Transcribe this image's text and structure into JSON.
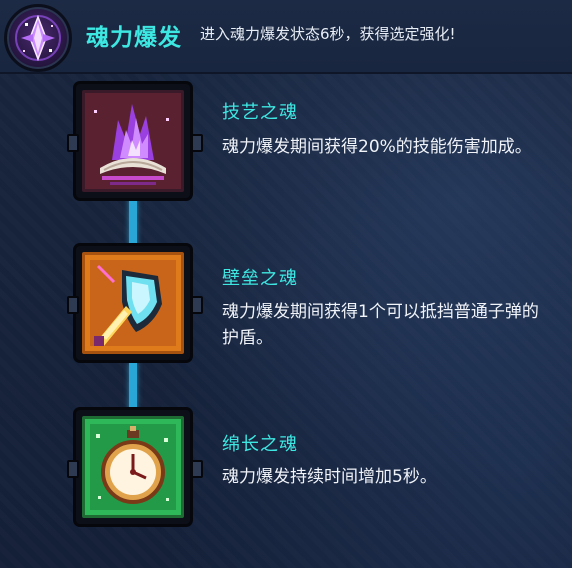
{
  "header": {
    "icon": "purple-crystal-icon",
    "title": "魂力爆发",
    "description": "进入魂力爆发状态6秒，获得选定强化!"
  },
  "items": [
    {
      "icon": "purple-flame-book-icon",
      "name": "技艺之魂",
      "description": "魂力爆发期间获得20%的技能伤害加成。",
      "frame_color": "#7a3fb0"
    },
    {
      "icon": "shield-sword-icon",
      "name": "壁垒之魂",
      "description": "魂力爆发期间获得1个可以抵挡普通子弹的护盾。",
      "frame_color": "#e07b1c"
    },
    {
      "icon": "stopwatch-icon",
      "name": "绵长之魂",
      "description": "魂力爆发持续时间增加5秒。",
      "frame_color": "#2fb85a"
    }
  ],
  "colors": {
    "accent": "#3ee8e2",
    "connector": "#2aa6d6",
    "text": "#f0f3f8"
  }
}
